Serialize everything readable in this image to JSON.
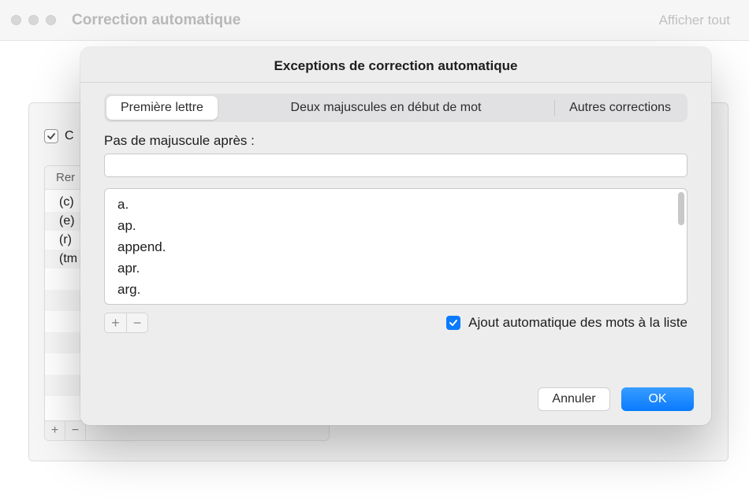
{
  "window": {
    "title": "Correction automatique",
    "show_all": "Afficher tout"
  },
  "background": {
    "checkbox_label": "C",
    "table_header": "Rer",
    "rows": [
      "(c)",
      "(e)",
      "(r)",
      "(tm"
    ]
  },
  "sheet": {
    "title": "Exceptions de correction automatique",
    "tabs": [
      "Première lettre",
      "Deux majuscules en début de mot",
      "Autres corrections"
    ],
    "active_tab_index": 0,
    "prompt": "Pas de majuscule après :",
    "input_value": "",
    "list_items": [
      "a.",
      "ap.",
      "append.",
      "apr.",
      "arg."
    ],
    "auto_add_label": "Ajout automatique des mots à la liste",
    "auto_add_checked": true,
    "cancel": "Annuler",
    "ok": "OK"
  }
}
